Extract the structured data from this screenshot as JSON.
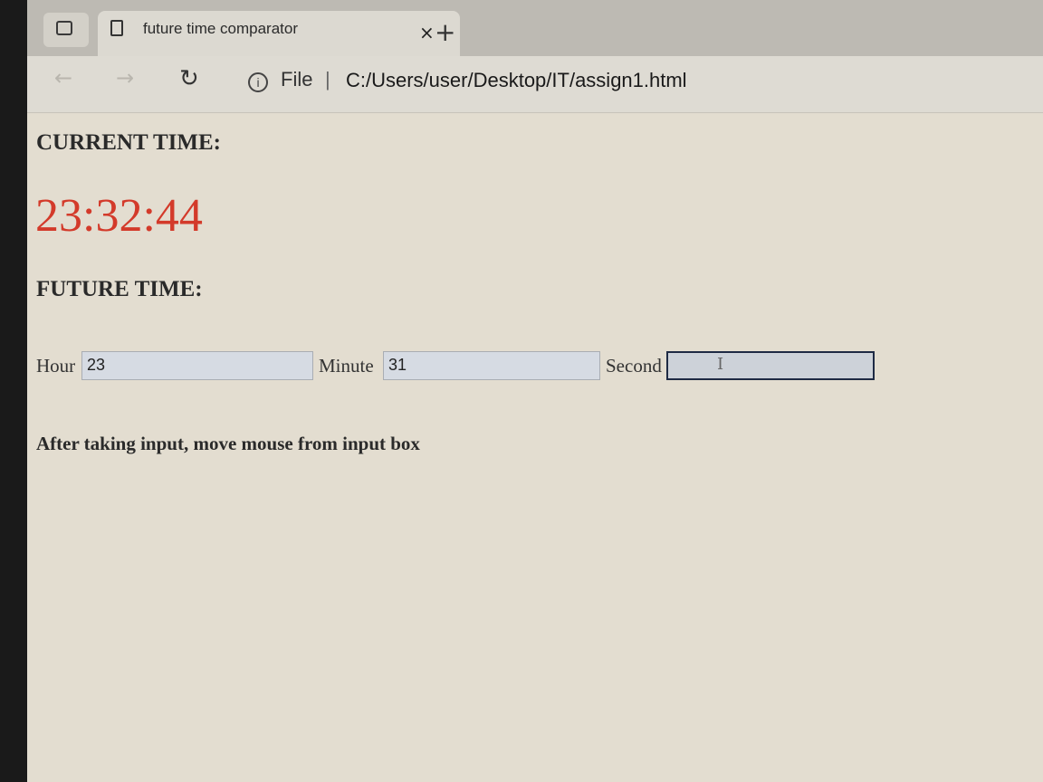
{
  "browser": {
    "tab_title": "future time comparator",
    "tab_close_glyph": "×",
    "new_tab_glyph": "+",
    "scheme_label": "File",
    "separator": "|",
    "url": "C:/Users/user/Desktop/IT/assign1.html",
    "info_glyph": "i"
  },
  "page": {
    "current_heading": "CURRENT TIME:",
    "current_time": "23:32:44",
    "future_heading": "FUTURE TIME:",
    "hour_label": "Hour",
    "hour_value": "23",
    "minute_label": "Minute",
    "minute_value": "31",
    "second_label": "Second",
    "second_value": "",
    "hint": "After taking input, move mouse from input box"
  },
  "colors": {
    "clock": "#d33a2a",
    "page_background": "#e3ddd0"
  },
  "icons": {
    "back": "arrow-left-icon",
    "forward": "arrow-right-icon",
    "reload": "reload-icon",
    "info": "info-icon",
    "page": "page-icon",
    "close": "close-icon",
    "new_tab": "plus-icon",
    "text_cursor": "text-cursor-icon"
  }
}
